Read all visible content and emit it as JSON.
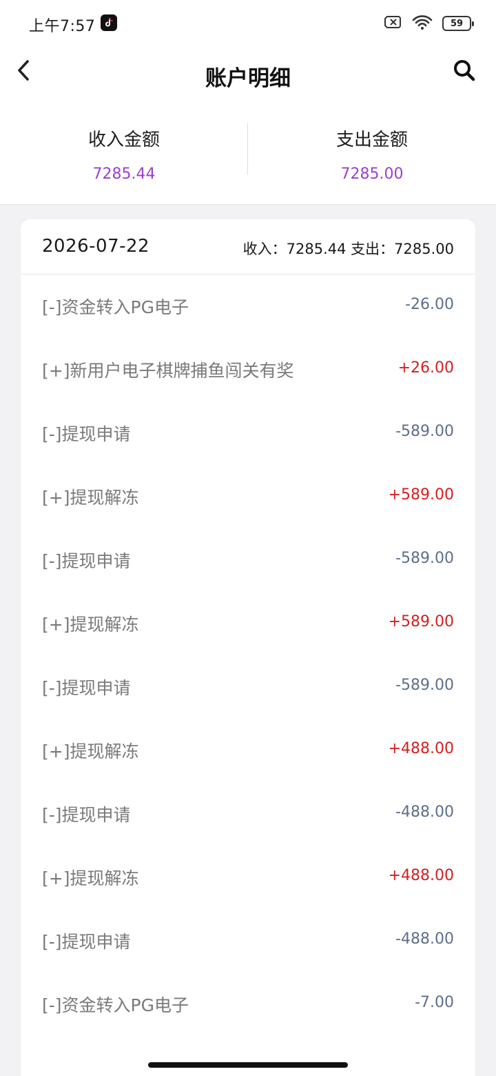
{
  "status_bar": {
    "time": "上午7:57",
    "battery": "59"
  },
  "header": {
    "title": "账户明细",
    "back_icon": "chevron-left-icon",
    "search_icon": "search-icon"
  },
  "summary": {
    "income_label": "收入金额",
    "income_value": "7285.44",
    "expense_label": "支出金额",
    "expense_value": "7285.00"
  },
  "colors": {
    "summary_value": "#9a3fd0",
    "negative_amount": "#5e6e8a",
    "positive_amount": "#d41f1f"
  },
  "day": {
    "date": "2026-07-22",
    "totals": "收入：7285.44 支出：7285.00"
  },
  "transactions": [
    {
      "desc": "[-]资金转入PG电子",
      "amount": "-26.00",
      "type": "neg"
    },
    {
      "desc": "[+]新用户电子棋牌捕鱼闯关有奖",
      "amount": "+26.00",
      "type": "pos"
    },
    {
      "desc": "[-]提现申请",
      "amount": "-589.00",
      "type": "neg"
    },
    {
      "desc": "[+]提现解冻",
      "amount": "+589.00",
      "type": "pos"
    },
    {
      "desc": "[-]提现申请",
      "amount": "-589.00",
      "type": "neg"
    },
    {
      "desc": "[+]提现解冻",
      "amount": "+589.00",
      "type": "pos"
    },
    {
      "desc": "[-]提现申请",
      "amount": "-589.00",
      "type": "neg"
    },
    {
      "desc": "[+]提现解冻",
      "amount": "+488.00",
      "type": "pos"
    },
    {
      "desc": "[-]提现申请",
      "amount": "-488.00",
      "type": "neg"
    },
    {
      "desc": "[+]提现解冻",
      "amount": "+488.00",
      "type": "pos"
    },
    {
      "desc": "[-]提现申请",
      "amount": "-488.00",
      "type": "neg"
    },
    {
      "desc": "[-]资金转入PG电子",
      "amount": "-7.00",
      "type": "neg"
    }
  ]
}
